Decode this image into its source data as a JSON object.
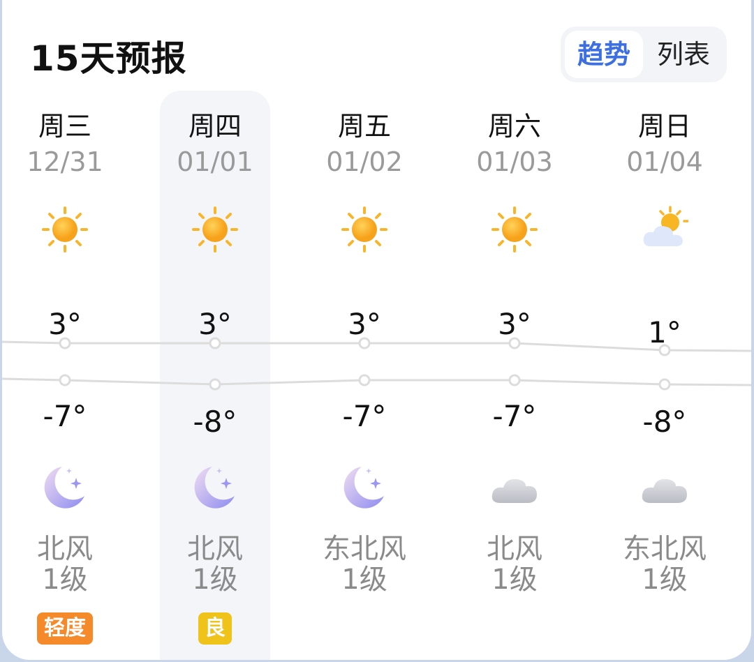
{
  "header": {
    "title": "15天预报",
    "toggle": {
      "trend_label": "趋势",
      "list_label": "列表"
    }
  },
  "colors": {
    "accent": "#3d6fe0",
    "aqi_light": "#f58a2a",
    "aqi_good": "#efc31a",
    "line": "#dcdcdc"
  },
  "days": [
    {
      "dow": "周三",
      "date": "12/31",
      "day_icon": "sun-icon",
      "high": "3°",
      "low": "-7°",
      "night_icon": "moon-icon",
      "wind_dir": "北风",
      "wind_level": "1级",
      "aqi": "轻度",
      "aqi_color": "#f58a2a"
    },
    {
      "dow": "周四",
      "date": "01/01",
      "day_icon": "sun-icon",
      "high": "3°",
      "low": "-8°",
      "night_icon": "moon-icon",
      "wind_dir": "北风",
      "wind_level": "1级",
      "aqi": "良",
      "aqi_color": "#efc31a"
    },
    {
      "dow": "周五",
      "date": "01/02",
      "day_icon": "sun-icon",
      "high": "3°",
      "low": "-7°",
      "night_icon": "moon-icon",
      "wind_dir": "东北风",
      "wind_level": "1级"
    },
    {
      "dow": "周六",
      "date": "01/03",
      "day_icon": "sun-icon",
      "high": "3°",
      "low": "-7°",
      "night_icon": "cloud-icon",
      "wind_dir": "北风",
      "wind_level": "1级"
    },
    {
      "dow": "周日",
      "date": "01/04",
      "day_icon": "partly-cloudy-icon",
      "high": "1°",
      "low": "-8°",
      "night_icon": "cloud-icon",
      "wind_dir": "东北风",
      "wind_level": "1级"
    }
  ]
}
